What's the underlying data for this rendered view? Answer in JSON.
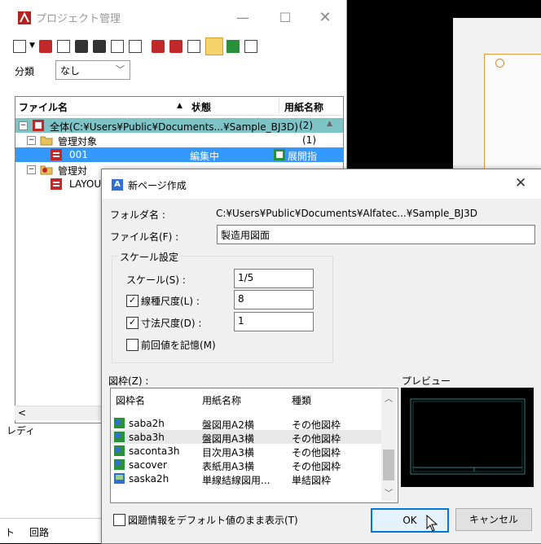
{
  "project_window": {
    "title": "プロジェクト管理",
    "category_label": "分類",
    "category_value": "なし",
    "tree_headers": [
      "ファイル名",
      "状態",
      "用紙名称"
    ],
    "tree_rows": [
      {
        "name": "全体(C:¥Users¥Public¥Documents...¥Sample_BJ3D)",
        "status": "(2)",
        "paper": ""
      },
      {
        "name": "管理対象",
        "status": "(1)",
        "paper": ""
      },
      {
        "name": "001",
        "status": "編集中",
        "paper": "展開指"
      },
      {
        "name": "管理対",
        "status": "",
        "paper": ""
      },
      {
        "name": "LAYOU",
        "status": "",
        "paper": ""
      }
    ],
    "status_text": "レディ",
    "bottom_tabs": [
      "ト",
      "回路"
    ]
  },
  "dialog": {
    "title": "新ページ作成",
    "folder_label": "フォルダ名 :",
    "folder_value": "C:¥Users¥Public¥Documents¥Alfatec...¥Sample_BJ3D",
    "filename_label": "ファイル名(F) :",
    "filename_value": "製造用図面",
    "scale_group_label": "スケール設定",
    "scale_label": "スケール(S) :",
    "scale_value": "1/5",
    "linetype_label": "線種尺度(L) :",
    "linetype_value": "8",
    "dimension_label": "寸法尺度(D) :",
    "dimension_value": "1",
    "remember_label": "前回値を記憶(M)",
    "frame_label": "図枠(Z) :",
    "preview_label": "プレビュー",
    "list_headers": [
      "図枠名",
      "用紙名称",
      "種類"
    ],
    "list_rows": [
      {
        "name": "saba2h",
        "paper": "盤図用A2横",
        "type": "その他図枠"
      },
      {
        "name": "saba3h",
        "paper": "盤図用A3横",
        "type": "その他図枠"
      },
      {
        "name": "saconta3h",
        "paper": "目次用A3横",
        "type": "その他図枠"
      },
      {
        "name": "sacover",
        "paper": "表紙用A3横",
        "type": "その他図枠"
      },
      {
        "name": "saska2h",
        "paper": "単線結線図用...",
        "type": "単結図枠"
      }
    ],
    "default_show_label": "図題情報をデフォルト値のまま表示(T)",
    "ok_label": "OK",
    "cancel_label": "キャンセル",
    "checks": {
      "linetype": true,
      "dimension": true,
      "remember": false,
      "default_show": false
    }
  }
}
